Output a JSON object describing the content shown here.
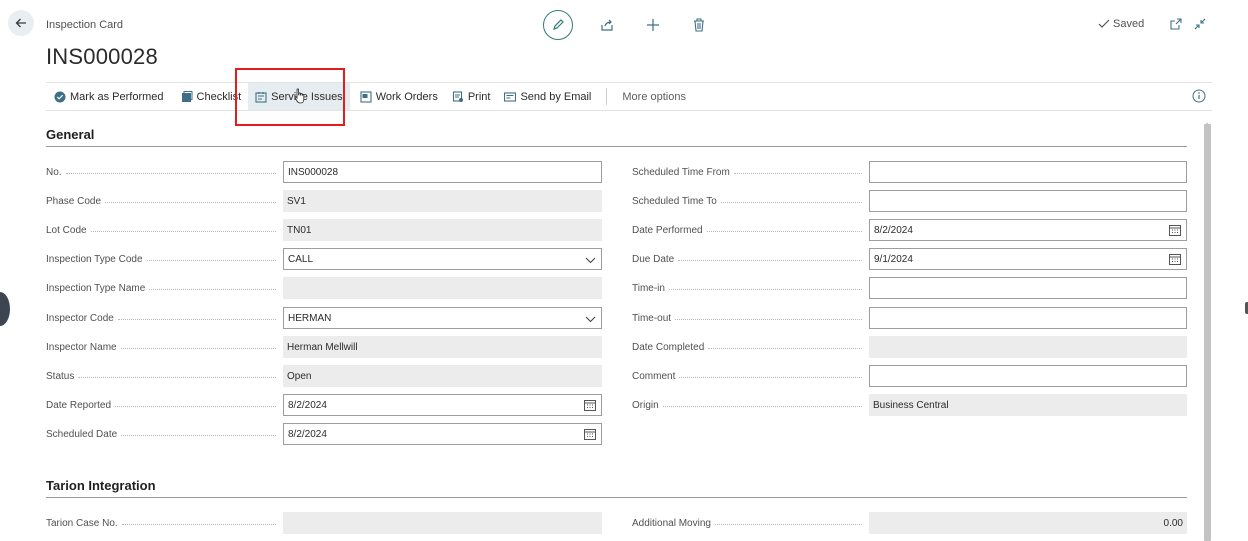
{
  "header": {
    "breadcrumb": "Inspection Card",
    "title": "INS000028",
    "saved_label": "Saved",
    "icons": [
      "back-arrow-icon",
      "edit-pencil-icon",
      "share-icon",
      "plus-icon",
      "delete-icon",
      "checkmark-icon",
      "open-new-window-icon",
      "collapse-icon"
    ]
  },
  "actions": {
    "mark_performed": "Mark as Performed",
    "checklist": "Checklist",
    "service_issues": "Service Issues",
    "work_orders": "Work Orders",
    "print": "Print",
    "send_email": "Send by Email",
    "more_options": "More options"
  },
  "general": {
    "title": "General",
    "left": [
      {
        "label": "No.",
        "value": "INS000028",
        "kind": "input"
      },
      {
        "label": "Phase Code",
        "value": "SV1",
        "kind": "readonly"
      },
      {
        "label": "Lot Code",
        "value": "TN01",
        "kind": "readonly"
      },
      {
        "label": "Inspection Type Code",
        "value": "CALL",
        "kind": "dropdown"
      },
      {
        "label": "Inspection Type Name",
        "value": "",
        "kind": "readonly"
      },
      {
        "label": "Inspector Code",
        "value": "HERMAN",
        "kind": "dropdown"
      },
      {
        "label": "Inspector Name",
        "value": "Herman Mellwill",
        "kind": "readonly"
      },
      {
        "label": "Status",
        "value": "Open",
        "kind": "readonly"
      },
      {
        "label": "Date Reported",
        "value": "8/2/2024",
        "kind": "date"
      },
      {
        "label": "Scheduled Date",
        "value": "8/2/2024",
        "kind": "date"
      }
    ],
    "right": [
      {
        "label": "Scheduled Time From",
        "value": "",
        "kind": "input"
      },
      {
        "label": "Scheduled Time To",
        "value": "",
        "kind": "input"
      },
      {
        "label": "Date Performed",
        "value": "8/2/2024",
        "kind": "date"
      },
      {
        "label": "Due Date",
        "value": "9/1/2024",
        "kind": "date"
      },
      {
        "label": "Time-in",
        "value": "",
        "kind": "input"
      },
      {
        "label": "Time-out",
        "value": "",
        "kind": "input"
      },
      {
        "label": "Date Completed",
        "value": "",
        "kind": "readonly"
      },
      {
        "label": "Comment",
        "value": "",
        "kind": "input"
      },
      {
        "label": "Origin",
        "value": "Business Central",
        "kind": "readonly"
      }
    ]
  },
  "tarion": {
    "title": "Tarion Integration",
    "left": [
      {
        "label": "Tarion Case No.",
        "value": "",
        "kind": "readonly"
      }
    ],
    "right": [
      {
        "label": "Additional Moving",
        "value": "0.00",
        "kind": "readonly-right"
      }
    ]
  },
  "colors": {
    "accent": "#2f7d76",
    "highlight": "#e01e1e",
    "hover_bg": "#e6edf1",
    "readonly_bg": "#ececec"
  }
}
